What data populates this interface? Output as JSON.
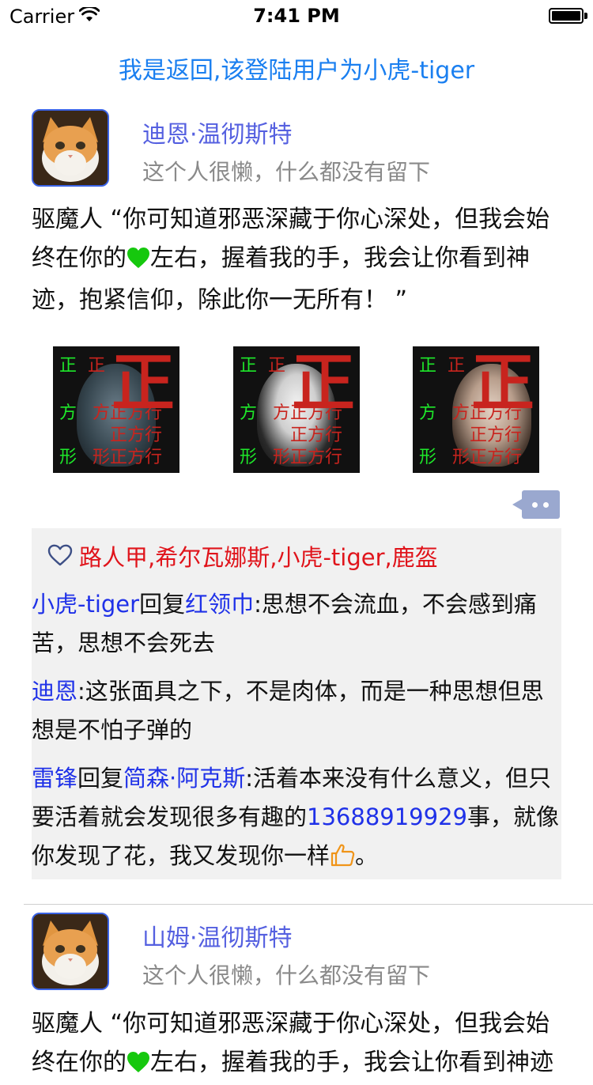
{
  "status_bar": {
    "carrier": "Carrier",
    "time": "7:41 PM",
    "battery_level": 1.0
  },
  "nav": {
    "back_label": "我是返回,该登陆用户为小虎-tiger"
  },
  "posts": [
    {
      "author": "迪恩·温彻斯特",
      "signature": "这个人很懒，什么都没有留下",
      "text_before_emoji": "驱魔人 “你可知道邪恶深藏于你心深处，但我会始终在你的",
      "text_after_emoji": "左右，握着我的手，我会让你看到神迹，抱紧信仰，除此你一无所有！ ”",
      "images": [
        {
          "small_top": "正",
          "small_mid": "正",
          "left_col": [
            "正",
            "方",
            "形"
          ],
          "rows": [
            "方正方行",
            "正方行",
            "形正方行"
          ],
          "big": "正"
        },
        {
          "small_top": "正",
          "small_mid": "正",
          "left_col": [
            "正",
            "方",
            "形"
          ],
          "rows": [
            "方正方行",
            "正方行",
            "形正方行"
          ],
          "big": "正"
        },
        {
          "small_top": "正",
          "small_mid": "正",
          "left_col": [
            "正",
            "方",
            "形"
          ],
          "rows": [
            "方正方行",
            "正方行",
            "形正方行"
          ],
          "big": "正"
        }
      ],
      "likes": {
        "names": [
          "路人甲",
          "希尔瓦娜斯",
          "小虎-tiger",
          "鹿盔"
        ],
        "text": "路人甲,希尔瓦娜斯,小虎-tiger,鹿盔"
      },
      "comments": [
        {
          "from": "小虎-tiger",
          "reply_word": "回复",
          "to": "红领巾",
          "body": ":思想不会流血，不会感到痛苦，思想不会死去"
        },
        {
          "from": "迪恩",
          "body": ":这张面具之下，不是肉体，而是一种思想但思想是不怕子弹的"
        },
        {
          "from": "雷锋",
          "reply_word": "回复",
          "to": "简森·阿克斯",
          "body_before": ":活着本来没有什么意义，但只要活着就会发现很多有趣的",
          "phone": "13688919929",
          "body_after": "事，就像你发现了花，我又发现你一样",
          "end": "。"
        }
      ]
    },
    {
      "author": "山姆·温彻斯特",
      "signature": "这个人很懒，什么都没有留下",
      "text_before_emoji": "驱魔人 “你可知道邪恶深藏于你心深处，但我会始终在你的",
      "text_after_emoji": "左右，握着我的手，我会让你看到神迹"
    }
  ],
  "colors": {
    "link": "#1a7ff0",
    "name": "#5560e0",
    "like_red": "#e0141b",
    "comment_blue": "#1f31e8",
    "comment_bg": "#f1f1f1"
  },
  "icons": [
    "wifi-icon",
    "battery-icon",
    "cat-avatar",
    "heart-emoji",
    "more-icon",
    "like-heart-icon",
    "thumbs-up-icon"
  ]
}
